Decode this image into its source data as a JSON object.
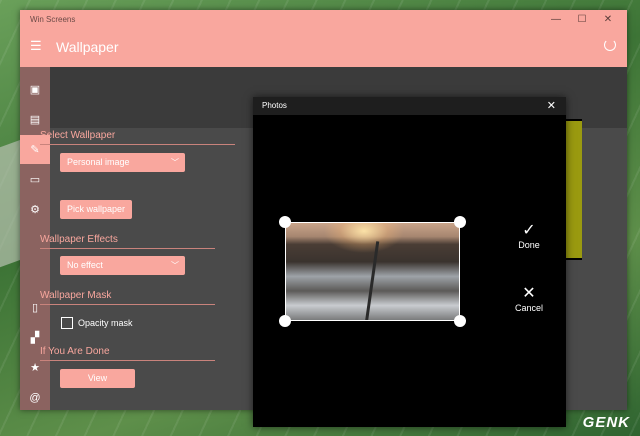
{
  "window": {
    "app_title": "Win Screens",
    "page_title": "Wallpaper",
    "controls": {
      "minimize": "—",
      "maximize": "☐",
      "close": "✕"
    }
  },
  "sidebar": {
    "items": [
      {
        "icon": "image-icon",
        "glyph": "▣"
      },
      {
        "icon": "gallery-icon",
        "glyph": "▤"
      },
      {
        "icon": "wallpaper-icon",
        "glyph": "✎",
        "active": true
      },
      {
        "icon": "taskbar-icon",
        "glyph": "▭"
      },
      {
        "icon": "settings-icon",
        "glyph": "⚙"
      },
      {
        "icon": "clipboard-icon",
        "glyph": "▯"
      },
      {
        "icon": "apps-icon",
        "glyph": "▞"
      },
      {
        "icon": "star-icon",
        "glyph": "★"
      },
      {
        "icon": "at-icon",
        "glyph": "@"
      }
    ]
  },
  "settings": {
    "select_wallpaper": {
      "heading": "Select Wallpaper",
      "dropdown_value": "Personal image",
      "pick_label": "Pick wallpaper"
    },
    "effects": {
      "heading": "Wallpaper Effects",
      "dropdown_value": "No effect"
    },
    "mask": {
      "heading": "Wallpaper Mask",
      "opacity_label": "Opacity mask",
      "opacity_checked": false
    },
    "done": {
      "heading": "If You Are Done",
      "view_label": "View"
    }
  },
  "photos_dialog": {
    "title": "Photos",
    "close_glyph": "✕",
    "done_label": "Done",
    "done_glyph": "✓",
    "cancel_label": "Cancel",
    "cancel_glyph": "✕"
  },
  "watermark": "GENK",
  "colors": {
    "accent": "#f9a79e",
    "sidebar": "#8b6360",
    "background": "#4a4a4a"
  }
}
